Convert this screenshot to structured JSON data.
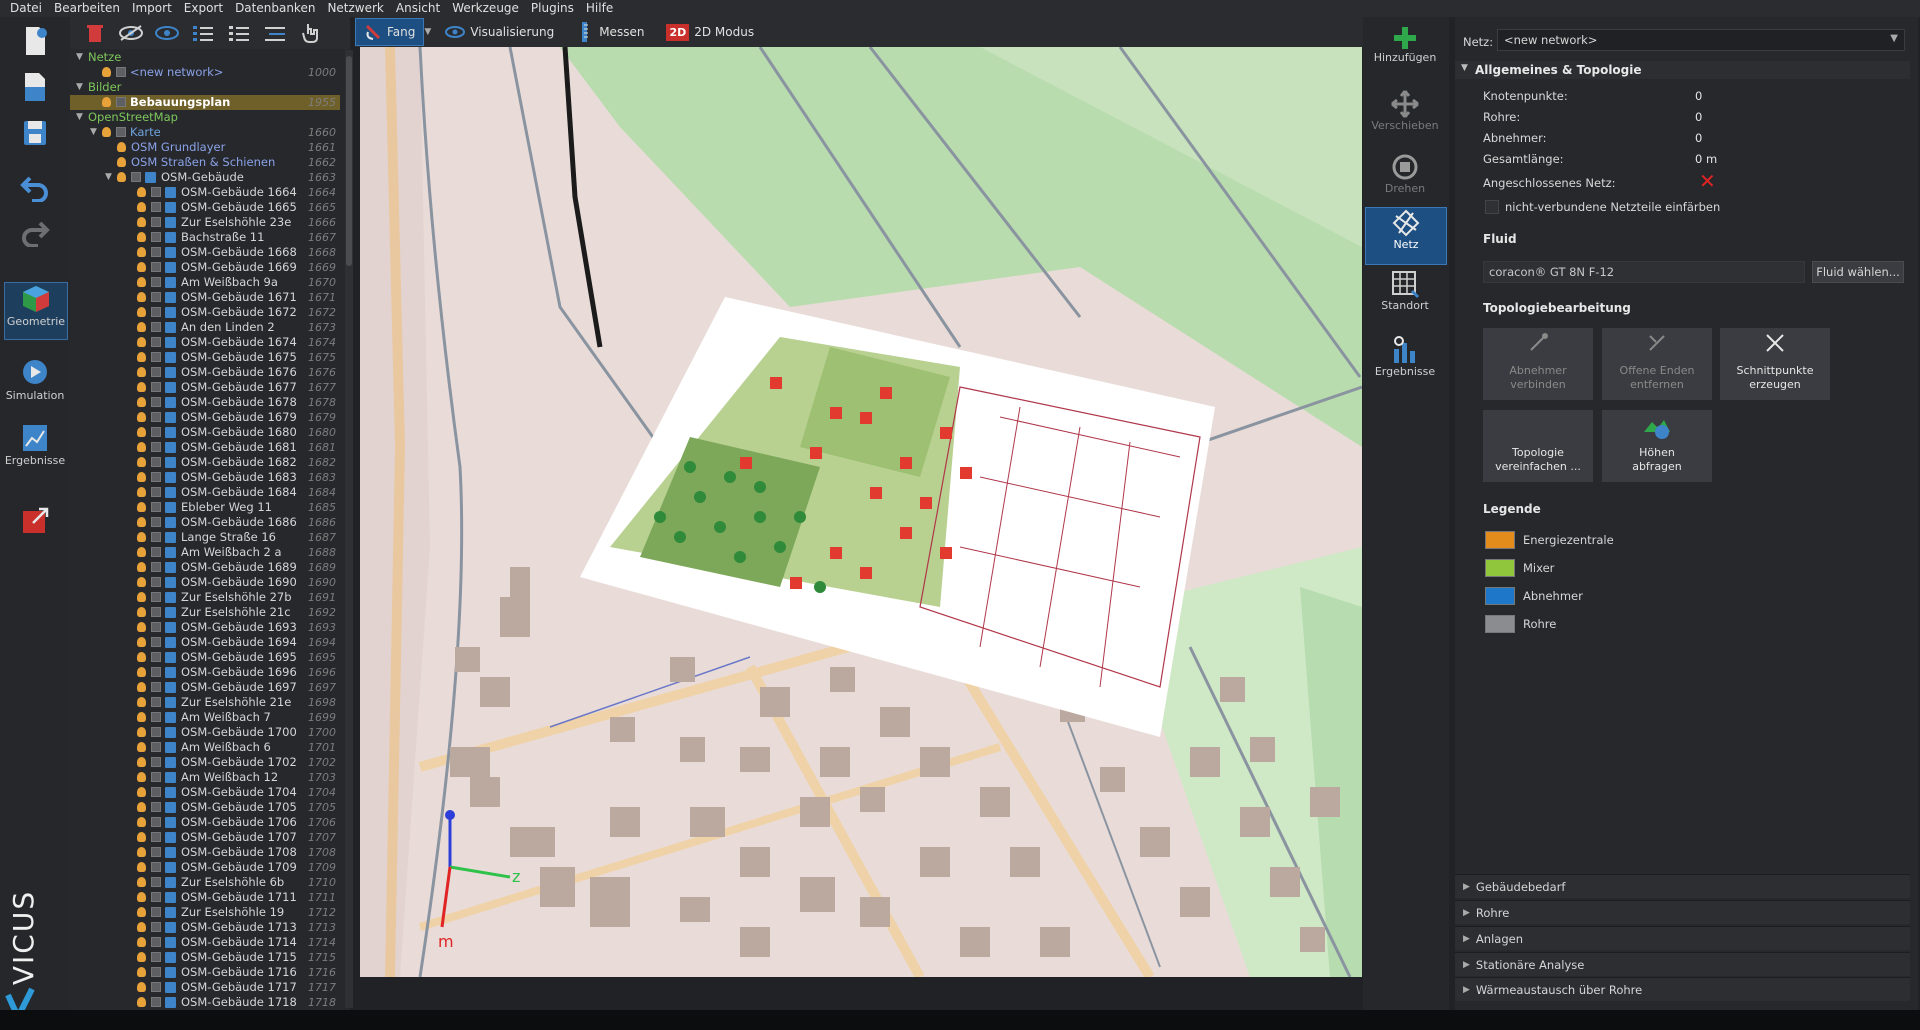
{
  "menu": [
    "Datei",
    "Bearbeiten",
    "Import",
    "Export",
    "Datenbanken",
    "Netzwerk",
    "Ansicht",
    "Werkzeuge",
    "Plugins",
    "Hilfe"
  ],
  "left_toolbar": {
    "geometrie": "Geometrie",
    "simulation": "Simulation",
    "ergebnisse": "Ergebnisse"
  },
  "brand": "VICUS",
  "view_toolbar": {
    "fang": "Fang",
    "visualisierung": "Visualisierung",
    "messen": "Messen",
    "modus_badge": "2D",
    "modus": "2D Modus"
  },
  "tree": [
    {
      "label": "Netze",
      "arrow": "▼",
      "level": 0,
      "style": "green",
      "icons": ""
    },
    {
      "label": "<new network>",
      "level": 1,
      "style": "link",
      "icons": "bulb-box",
      "num": "1000"
    },
    {
      "label": "Bilder",
      "arrow": "▼",
      "level": 0,
      "style": "green",
      "icons": ""
    },
    {
      "label": "Bebauungsplan",
      "level": 1,
      "style": "selected",
      "icons": "bulb-box",
      "num": "1955",
      "selected": true
    },
    {
      "label": "OpenStreetMap",
      "arrow": "▼",
      "level": 0,
      "style": "green",
      "icons": ""
    },
    {
      "label": "Karte",
      "arrow": "▼",
      "level": 1,
      "style": "blue",
      "icons": "bulb-box",
      "num": "1660"
    },
    {
      "label": "OSM Grundlayer",
      "level": 2,
      "style": "link",
      "icons": "bulb",
      "num": "1661"
    },
    {
      "label": "OSM Straßen & Schienen",
      "level": 2,
      "style": "link",
      "icons": "bulb",
      "num": "1662"
    },
    {
      "label": "OSM-Gebäude",
      "arrow": "▼",
      "level": 2,
      "style": "plain",
      "icons": "bulb-box-bld",
      "num": "1663"
    },
    {
      "label": "OSM-Gebäude 1664",
      "level": 3,
      "icons": "bulb-box-bld",
      "num": "1664"
    },
    {
      "label": "OSM-Gebäude 1665",
      "level": 3,
      "icons": "bulb-box-bld",
      "num": "1665"
    },
    {
      "label": "Zur Eselshöhle 23e",
      "level": 3,
      "icons": "bulb-box-bld",
      "num": "1666"
    },
    {
      "label": "Bachstraße 11",
      "level": 3,
      "icons": "bulb-box-bld",
      "num": "1667"
    },
    {
      "label": "OSM-Gebäude 1668",
      "level": 3,
      "icons": "bulb-box-bld",
      "num": "1668"
    },
    {
      "label": "OSM-Gebäude 1669",
      "level": 3,
      "icons": "bulb-box-bld",
      "num": "1669"
    },
    {
      "label": "Am Weißbach 9a",
      "level": 3,
      "icons": "bulb-box-bld",
      "num": "1670"
    },
    {
      "label": "OSM-Gebäude 1671",
      "level": 3,
      "icons": "bulb-box-bld",
      "num": "1671"
    },
    {
      "label": "OSM-Gebäude 1672",
      "level": 3,
      "icons": "bulb-box-bld",
      "num": "1672"
    },
    {
      "label": "An den Linden 2",
      "level": 3,
      "icons": "bulb-box-bld",
      "num": "1673"
    },
    {
      "label": "OSM-Gebäude 1674",
      "level": 3,
      "icons": "bulb-box-bld",
      "num": "1674"
    },
    {
      "label": "OSM-Gebäude 1675",
      "level": 3,
      "icons": "bulb-box-bld",
      "num": "1675"
    },
    {
      "label": "OSM-Gebäude 1676",
      "level": 3,
      "icons": "bulb-box-bld",
      "num": "1676"
    },
    {
      "label": "OSM-Gebäude 1677",
      "level": 3,
      "icons": "bulb-box-bld",
      "num": "1677"
    },
    {
      "label": "OSM-Gebäude 1678",
      "level": 3,
      "icons": "bulb-box-bld",
      "num": "1678"
    },
    {
      "label": "OSM-Gebäude 1679",
      "level": 3,
      "icons": "bulb-box-bld",
      "num": "1679"
    },
    {
      "label": "OSM-Gebäude 1680",
      "level": 3,
      "icons": "bulb-box-bld",
      "num": "1680"
    },
    {
      "label": "OSM-Gebäude 1681",
      "level": 3,
      "icons": "bulb-box-bld",
      "num": "1681"
    },
    {
      "label": "OSM-Gebäude 1682",
      "level": 3,
      "icons": "bulb-box-bld",
      "num": "1682"
    },
    {
      "label": "OSM-Gebäude 1683",
      "level": 3,
      "icons": "bulb-box-bld",
      "num": "1683"
    },
    {
      "label": "OSM-Gebäude 1684",
      "level": 3,
      "icons": "bulb-box-bld",
      "num": "1684"
    },
    {
      "label": "Ebleber Weg 11",
      "level": 3,
      "icons": "bulb-box-bld",
      "num": "1685"
    },
    {
      "label": "OSM-Gebäude 1686",
      "level": 3,
      "icons": "bulb-box-bld",
      "num": "1686"
    },
    {
      "label": "Lange Straße 16",
      "level": 3,
      "icons": "bulb-box-bld",
      "num": "1687"
    },
    {
      "label": "Am Weißbach 2 a",
      "level": 3,
      "icons": "bulb-box-bld",
      "num": "1688"
    },
    {
      "label": "OSM-Gebäude 1689",
      "level": 3,
      "icons": "bulb-box-bld",
      "num": "1689"
    },
    {
      "label": "OSM-Gebäude 1690",
      "level": 3,
      "icons": "bulb-box-bld",
      "num": "1690"
    },
    {
      "label": "Zur Eselshöhle 27b",
      "level": 3,
      "icons": "bulb-box-bld",
      "num": "1691"
    },
    {
      "label": "Zur Eselshöhle 21c",
      "level": 3,
      "icons": "bulb-box-bld",
      "num": "1692"
    },
    {
      "label": "OSM-Gebäude 1693",
      "level": 3,
      "icons": "bulb-box-bld",
      "num": "1693"
    },
    {
      "label": "OSM-Gebäude 1694",
      "level": 3,
      "icons": "bulb-box-bld",
      "num": "1694"
    },
    {
      "label": "OSM-Gebäude 1695",
      "level": 3,
      "icons": "bulb-box-bld",
      "num": "1695"
    },
    {
      "label": "OSM-Gebäude 1696",
      "level": 3,
      "icons": "bulb-box-bld",
      "num": "1696"
    },
    {
      "label": "OSM-Gebäude 1697",
      "level": 3,
      "icons": "bulb-box-bld",
      "num": "1697"
    },
    {
      "label": "Zur Eselshöhle 21e",
      "level": 3,
      "icons": "bulb-box-bld",
      "num": "1698"
    },
    {
      "label": "Am Weißbach 7",
      "level": 3,
      "icons": "bulb-box-bld",
      "num": "1699"
    },
    {
      "label": "OSM-Gebäude 1700",
      "level": 3,
      "icons": "bulb-box-bld",
      "num": "1700"
    },
    {
      "label": "Am Weißbach 6",
      "level": 3,
      "icons": "bulb-box-bld",
      "num": "1701"
    },
    {
      "label": "OSM-Gebäude 1702",
      "level": 3,
      "icons": "bulb-box-bld",
      "num": "1702"
    },
    {
      "label": "Am Weißbach 12",
      "level": 3,
      "icons": "bulb-box-bld",
      "num": "1703"
    },
    {
      "label": "OSM-Gebäude 1704",
      "level": 3,
      "icons": "bulb-box-bld",
      "num": "1704"
    },
    {
      "label": "OSM-Gebäude 1705",
      "level": 3,
      "icons": "bulb-box-bld",
      "num": "1705"
    },
    {
      "label": "OSM-Gebäude 1706",
      "level": 3,
      "icons": "bulb-box-bld",
      "num": "1706"
    },
    {
      "label": "OSM-Gebäude 1707",
      "level": 3,
      "icons": "bulb-box-bld",
      "num": "1707"
    },
    {
      "label": "OSM-Gebäude 1708",
      "level": 3,
      "icons": "bulb-box-bld",
      "num": "1708"
    },
    {
      "label": "OSM-Gebäude 1709",
      "level": 3,
      "icons": "bulb-box-bld",
      "num": "1709"
    },
    {
      "label": "Zur Eselshöhle 6b",
      "level": 3,
      "icons": "bulb-box-bld",
      "num": "1710"
    },
    {
      "label": "OSM-Gebäude 1711",
      "level": 3,
      "icons": "bulb-box-bld",
      "num": "1711"
    },
    {
      "label": "Zur Eselshöhle 19",
      "level": 3,
      "icons": "bulb-box-bld",
      "num": "1712"
    },
    {
      "label": "OSM-Gebäude 1713",
      "level": 3,
      "icons": "bulb-box-bld",
      "num": "1713"
    },
    {
      "label": "OSM-Gebäude 1714",
      "level": 3,
      "icons": "bulb-box-bld",
      "num": "1714"
    },
    {
      "label": "OSM-Gebäude 1715",
      "level": 3,
      "icons": "bulb-box-bld",
      "num": "1715"
    },
    {
      "label": "OSM-Gebäude 1716",
      "level": 3,
      "icons": "bulb-box-bld",
      "num": "1716"
    },
    {
      "label": "OSM-Gebäude 1717",
      "level": 3,
      "icons": "bulb-box-bld",
      "num": "1717"
    },
    {
      "label": "OSM-Gebäude 1718",
      "level": 3,
      "icons": "bulb-box-bld",
      "num": "1718"
    }
  ],
  "action_bar": {
    "hinzufuegen": "Hinzufügen",
    "verschieben": "Verschieben",
    "drehen": "Drehen",
    "netz": "Netz",
    "standort": "Standort",
    "ergebnisse": "Ergebnisse"
  },
  "right_panel": {
    "netz_label": "Netz:",
    "netz_value": "<new network>",
    "section_general": "Allgemeines & Topologie",
    "knotenpunkte_label": "Knotenpunkte:",
    "knotenpunkte_value": "0",
    "rohre_label": "Rohre:",
    "rohre_value": "0",
    "abnehmer_label": "Abnehmer:",
    "abnehmer_value": "0",
    "gesamtlaenge_label": "Gesamtlänge:",
    "gesamtlaenge_value": "0 m",
    "angeschlossen_label": "Angeschlossenes Netz:",
    "einfaerben_label": "nicht-verbundene Netzteile einfärben",
    "fluid_title": "Fluid",
    "fluid_value": "coracon® GT 8N F-12",
    "fluid_button": "Fluid wählen...",
    "topo_title": "Topologiebearbeitung",
    "topo_buttons": {
      "abnehmer_verbinden": [
        "Abnehmer",
        "verbinden"
      ],
      "offene_enden": [
        "Offene Enden",
        "entfernen"
      ],
      "schnittpunkte": [
        "Schnittpunkte",
        "erzeugen"
      ],
      "topologie": [
        "Topologie",
        "vereinfachen ..."
      ],
      "hoehen": [
        "Höhen",
        "abfragen"
      ]
    },
    "legende_title": "Legende",
    "legend": [
      {
        "label": "Energiezentrale",
        "color": "#e38b1b"
      },
      {
        "label": "Mixer",
        "color": "#8fc63c"
      },
      {
        "label": "Abnehmer",
        "color": "#1f77c9"
      },
      {
        "label": "Rohre",
        "color": "#8a8c90"
      }
    ],
    "collapsible": [
      "Gebäudebedarf",
      "Rohre",
      "Anlagen",
      "Stationäre Analyse",
      "Wärmeaustausch über Rohre"
    ]
  },
  "axis": {
    "x": "m",
    "y": "",
    "z": "z"
  }
}
